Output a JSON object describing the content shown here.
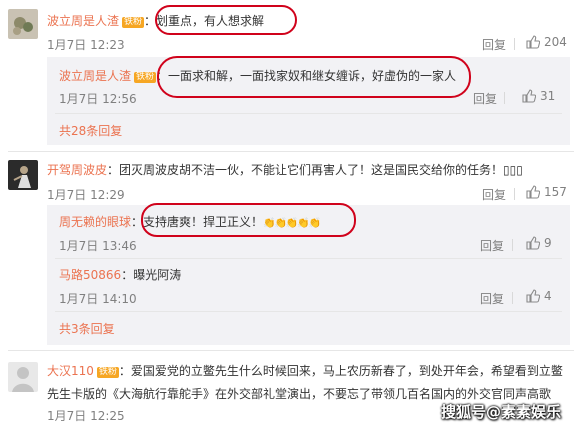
{
  "comments": [
    {
      "user": "波立周是人渣",
      "badge": "铁粉",
      "text": "：划重点，有人想求解",
      "time": "1月7日 12:23",
      "reply_label": "回复",
      "likes": "204",
      "replies": [
        {
          "user": "波立周是人渣",
          "badge": "铁粉",
          "text": "：一面求和解，一面找家奴和继女缠诉，好虚伪的一家人",
          "time": "1月7日 12:56",
          "reply_label": "回复",
          "likes": "31"
        }
      ],
      "more": "共28条回复"
    },
    {
      "user": "开驾周波皮",
      "text": "：团灭周波皮胡不洁一伙，不能让它们再害人了！这是国民交给你的任务！▯▯▯",
      "time": "1月7日 12:29",
      "reply_label": "回复",
      "likes": "157",
      "replies": [
        {
          "user": "周无赖的眼球",
          "text": "：支持唐爽！捍卫正义！",
          "emojis": "👏👏👏👏👏",
          "time": "1月7日 13:46",
          "reply_label": "回复",
          "likes": "9"
        },
        {
          "user": "马路50866",
          "text": "：曝光阿涛",
          "time": "1月7日 14:10",
          "reply_label": "回复",
          "likes": "4"
        }
      ],
      "more": "共3条回复"
    },
    {
      "user": "大汉110",
      "badge": "铁粉",
      "text_line1": "：爱国爱党的立鳖先生什么时候回来，马上农历新春了，到处开年会，希望看到立鳖",
      "text_line2": "先生卡版的《大海航行靠舵手》在外交部礼堂演出，不要忘了带领几百名国内的外交官同声高歌",
      "time": "1月7日 12:25"
    }
  ],
  "watermark": "搜狐号@素素娱乐",
  "colors": {
    "username": "#eb7350",
    "highlight_oval": "#d0021b",
    "reply_bg": "#f2f2f5",
    "badge_iron_fan": "#f6a623"
  }
}
